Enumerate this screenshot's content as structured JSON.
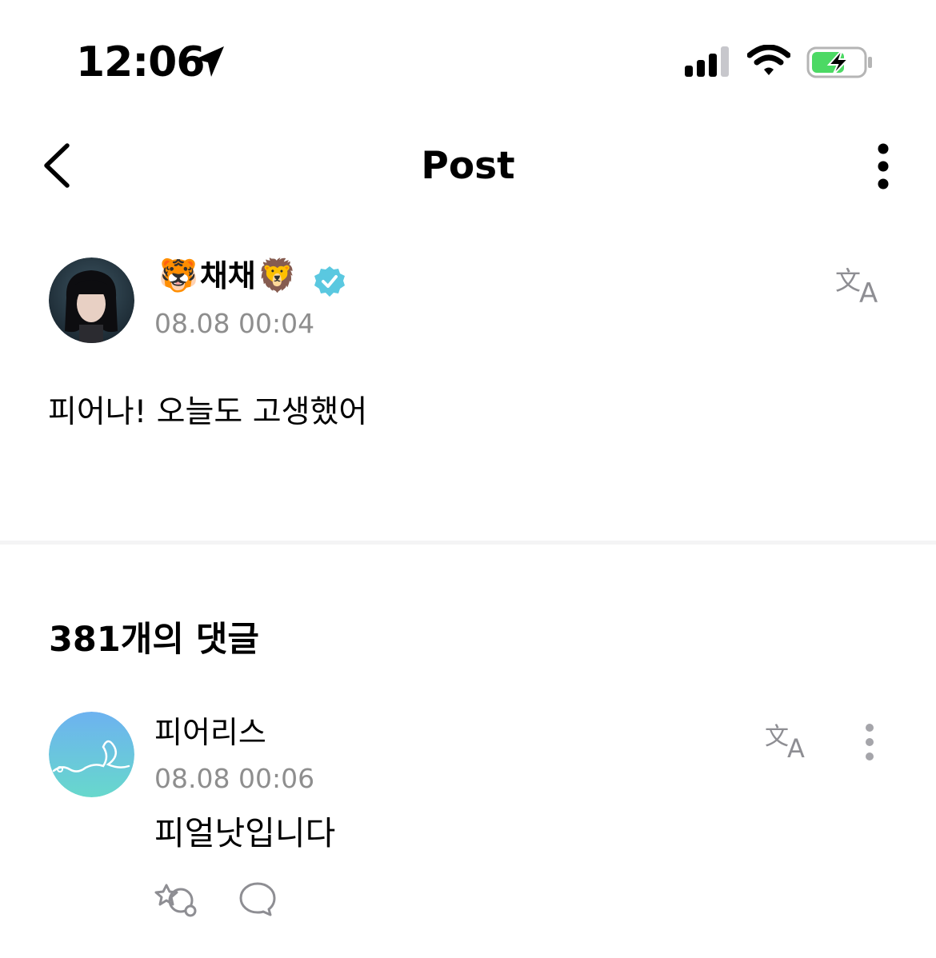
{
  "status_bar": {
    "time": "12:06",
    "location_icon": "location-arrow-icon",
    "signal_icon": "cellular-signal-icon",
    "wifi_icon": "wifi-icon",
    "battery_icon": "battery-charging-icon",
    "battery_color": "#4cd964"
  },
  "nav": {
    "title": "Post",
    "back_icon": "chevron-left-icon",
    "more_icon": "more-vertical-icon"
  },
  "post": {
    "author": {
      "emoji_left": "🐯",
      "name": "채채",
      "emoji_right": "🦁",
      "verified_icon": "verified-badge-icon",
      "verified_color": "#5ac8e0"
    },
    "timestamp": "08.08 00:04",
    "translate_icon": "translate-icon",
    "body": "피어나! 오늘도 고생했어"
  },
  "comments_section": {
    "count_label": "381개의 댓글",
    "comments": [
      {
        "author": "피어리스",
        "timestamp": "08.08 00:06",
        "text": "피얼낫입니다",
        "translate_icon": "translate-icon",
        "more_icon": "more-vertical-icon",
        "reaction_icon": "add-reaction-icon",
        "reply_icon": "reply-bubble-icon"
      }
    ]
  }
}
